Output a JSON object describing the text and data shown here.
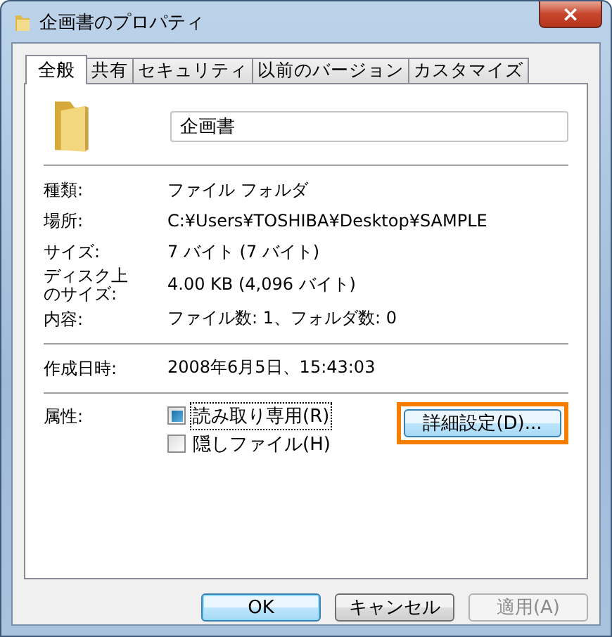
{
  "window": {
    "title": "企画書のプロパティ",
    "close": "×"
  },
  "tabs": [
    {
      "label": "全般",
      "selected": true
    },
    {
      "label": "共有",
      "selected": false
    },
    {
      "label": "セキュリティ",
      "selected": false
    },
    {
      "label": "以前のバージョン",
      "selected": false
    },
    {
      "label": "カスタマイズ",
      "selected": false
    }
  ],
  "name_field": {
    "value": "企画書"
  },
  "sections": [
    [
      {
        "label": "種類:",
        "value": "ファイル フォルダ"
      },
      {
        "label": "場所:",
        "value": "C:¥Users¥TOSHIBA¥Desktop¥SAMPLE"
      },
      {
        "label": "サイズ:",
        "value": "7 バイト (7 バイト)"
      },
      {
        "label": "ディスク上のサイズ:",
        "value": "4.00 KB (4,096 バイト)"
      },
      {
        "label": "内容:",
        "value": "ファイル数: 1、フォルダ数: 0"
      }
    ],
    [
      {
        "label": "作成日時:",
        "value": "2008年6月5日、15:43:03"
      }
    ]
  ],
  "attributes": {
    "label": "属性:",
    "checkboxes": [
      {
        "label": "読み取り専用(R)",
        "checked": false,
        "indeterminate": true,
        "focused": true
      },
      {
        "label": "隠しファイル(H)",
        "checked": false,
        "indeterminate": false,
        "focused": false
      }
    ],
    "advanced_button": {
      "label": "詳細設定(D)...",
      "highlighted": true
    }
  },
  "buttons": [
    {
      "label": "OK",
      "default": true,
      "disabled": false
    },
    {
      "label": "キャンセル",
      "default": false,
      "disabled": false
    },
    {
      "label": "適用(A)",
      "default": false,
      "disabled": true
    }
  ]
}
